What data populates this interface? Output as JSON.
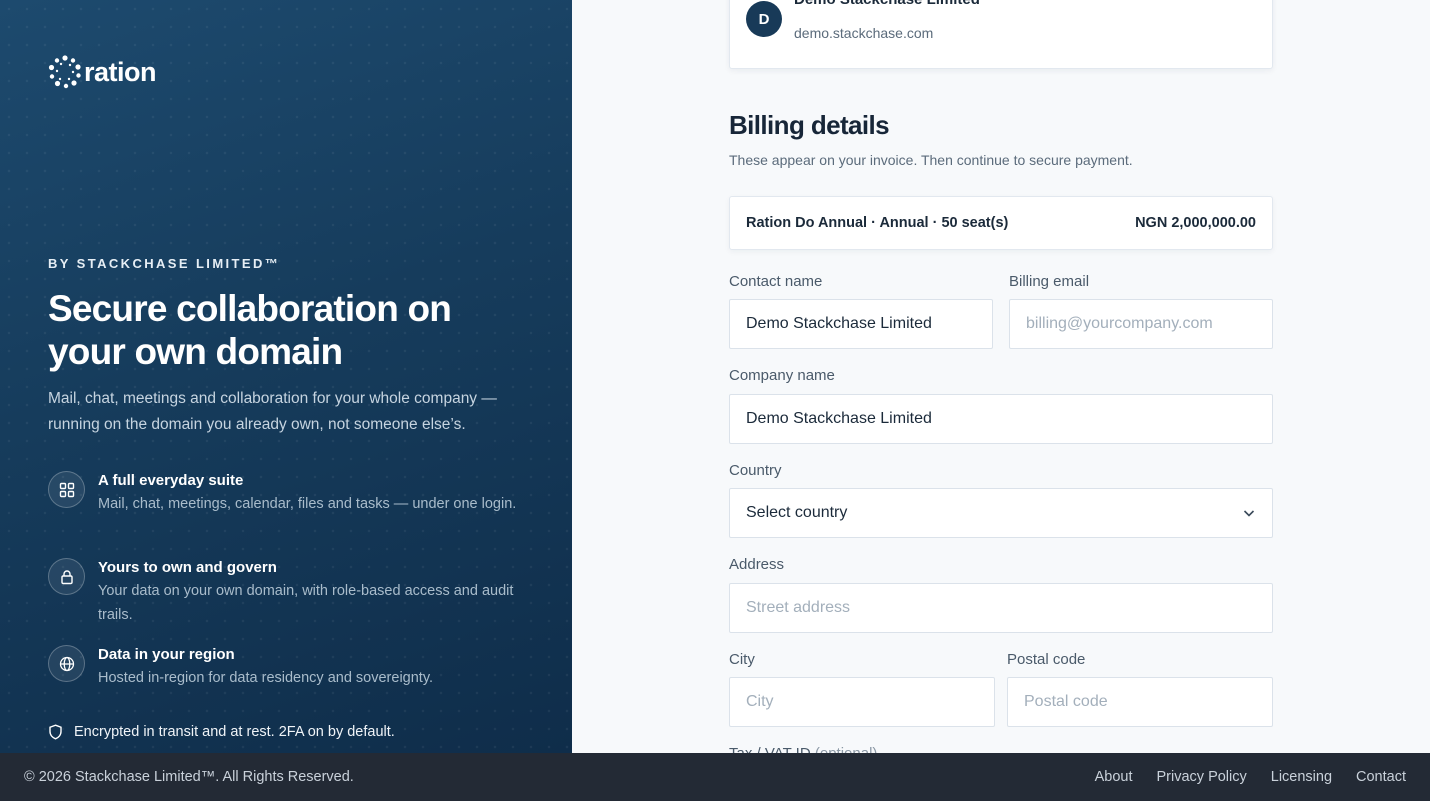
{
  "brand": {
    "name": "ration",
    "byline": "BY STACKCHASE LIMITED™",
    "headline": "Secure collaboration on your own domain",
    "intro": "Mail, chat, meetings and collaboration for your whole company — running on the domain you already own, not someone else’s.",
    "features": [
      {
        "icon": "grid-icon",
        "title": "A full everyday suite",
        "desc": "Mail, chat, meetings, calendar, files and tasks — under one login."
      },
      {
        "icon": "lock-icon",
        "title": "Yours to own and govern",
        "desc": "Your data on your own domain, with role-based access and audit trails."
      },
      {
        "icon": "globe-icon",
        "title": "Data in your region",
        "desc": "Hosted in-region for data residency and sovereignty."
      }
    ],
    "security_note": "Encrypted in transit and at rest. 2FA on by default.",
    "accent": "#1d4a6e"
  },
  "org": {
    "avatar_letter": "D",
    "name": "Demo Stackchase Limited",
    "domain": "demo.stackchase.com"
  },
  "billing": {
    "title": "Billing details",
    "subtitle": "These appear on your invoice. Then continue to secure payment.",
    "plan_label": "Ration Do Annual · Annual · 50 seat(s)",
    "plan_price": "NGN 2,000,000.00",
    "contact_name": {
      "label": "Contact name",
      "value": "Demo Stackchase Limited"
    },
    "billing_email": {
      "label": "Billing email",
      "value": "",
      "placeholder": "billing@yourcompany.com"
    },
    "company_name": {
      "label": "Company name",
      "value": "Demo Stackchase Limited"
    },
    "country": {
      "label": "Country",
      "value": "Select country"
    },
    "address": {
      "label": "Address",
      "value": "",
      "placeholder": "Street address"
    },
    "city": {
      "label": "City",
      "value": "",
      "placeholder": "City"
    },
    "postal_code": {
      "label": "Postal code",
      "value": "",
      "placeholder": "Postal code"
    },
    "tax_label": "Tax / VAT ID",
    "tax_optional": "(optional)"
  },
  "footer": {
    "copyright": "© 2026 Stackchase Limited™. All Rights Reserved.",
    "links": [
      "About",
      "Privacy Policy",
      "Licensing",
      "Contact"
    ]
  }
}
